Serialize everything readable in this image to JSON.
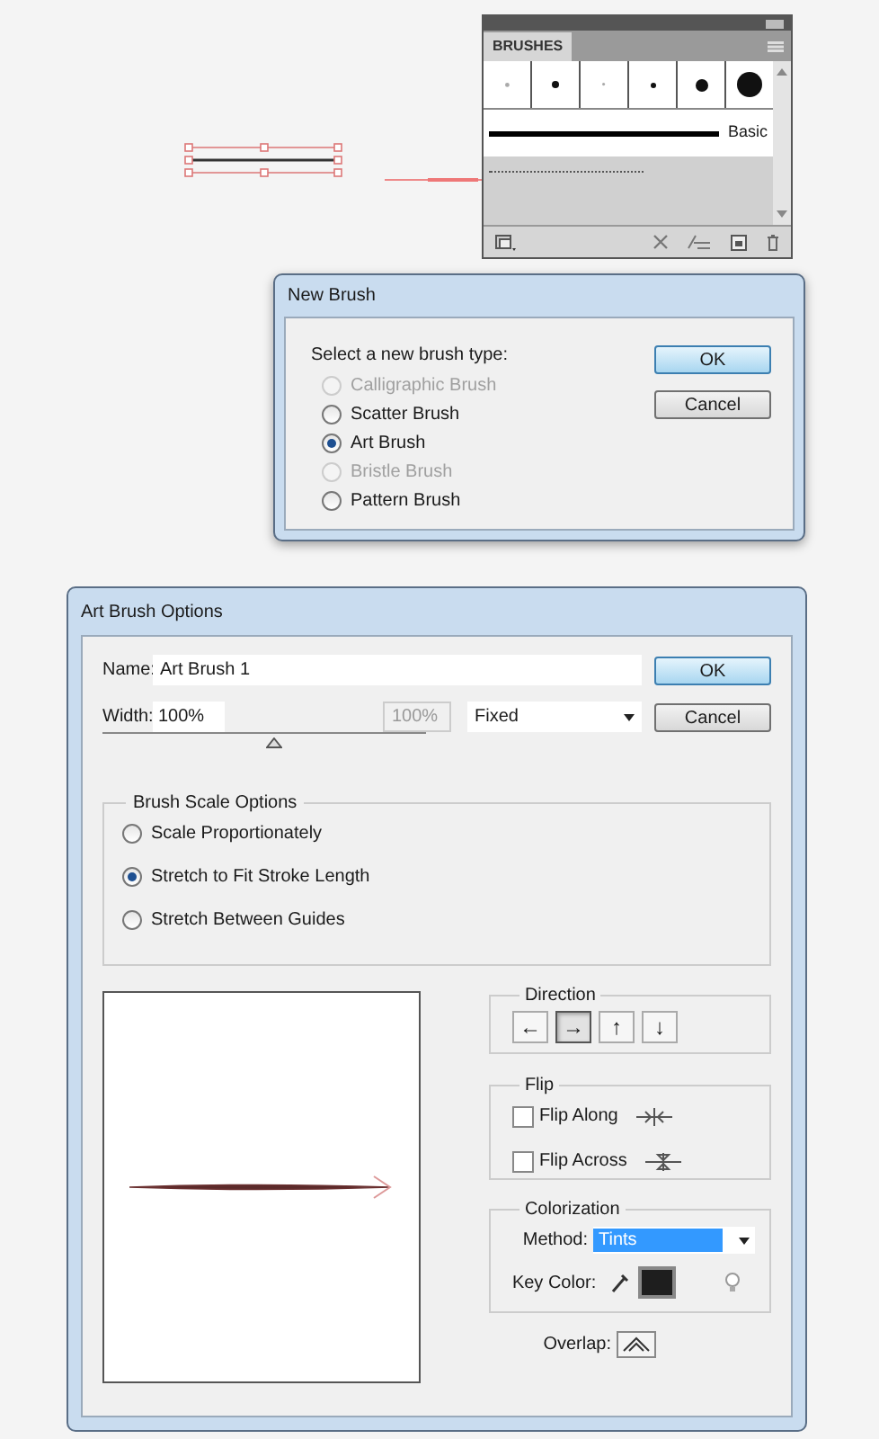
{
  "brushes_panel": {
    "tab": "BRUSHES",
    "rows": [
      {
        "label": "Basic",
        "selected": false
      },
      {
        "selected": true
      }
    ]
  },
  "new_brush": {
    "title": "New Brush",
    "prompt": "Select a new brush type:",
    "options": [
      {
        "label": "Calligraphic Brush",
        "selected": false,
        "disabled": true
      },
      {
        "label": "Scatter Brush",
        "selected": false,
        "disabled": false
      },
      {
        "label": "Art Brush",
        "selected": true,
        "disabled": false
      },
      {
        "label": "Bristle Brush",
        "selected": false,
        "disabled": true
      },
      {
        "label": "Pattern Brush",
        "selected": false,
        "disabled": false
      }
    ],
    "buttons": [
      "OK",
      "Cancel"
    ]
  },
  "art_brush_options": {
    "title": "Art Brush Options",
    "name_label": "Name:",
    "name_value": "Art Brush 1",
    "width_label": "Width:",
    "width_value": "100%",
    "width_max": "100%",
    "width_mode": "Fixed",
    "level": 0.53,
    "buttons": [
      "OK",
      "Cancel"
    ],
    "scale": {
      "title": "Brush Scale Options",
      "options": [
        {
          "label": "Scale Proportionately",
          "selected": false
        },
        {
          "label": "Stretch to Fit Stroke Length",
          "selected": true
        },
        {
          "label": "Stretch Between Guides",
          "selected": false
        }
      ]
    },
    "direction": {
      "title": "Direction",
      "buttons": [
        {
          "glyph": "←",
          "selected": false
        },
        {
          "glyph": "→",
          "selected": true
        },
        {
          "glyph": "↑",
          "selected": false
        },
        {
          "glyph": "↓",
          "selected": false
        }
      ]
    },
    "flip": {
      "title": "Flip",
      "options": [
        {
          "label": "Flip Along",
          "checked": false
        },
        {
          "label": "Flip Across",
          "checked": false
        }
      ]
    },
    "colorization": {
      "title": "Colorization",
      "method_label": "Method:",
      "method_value": "Tints",
      "key_color_label": "Key Color:",
      "color": "#1e1e1e"
    },
    "overlap_label": "Overlap:"
  }
}
